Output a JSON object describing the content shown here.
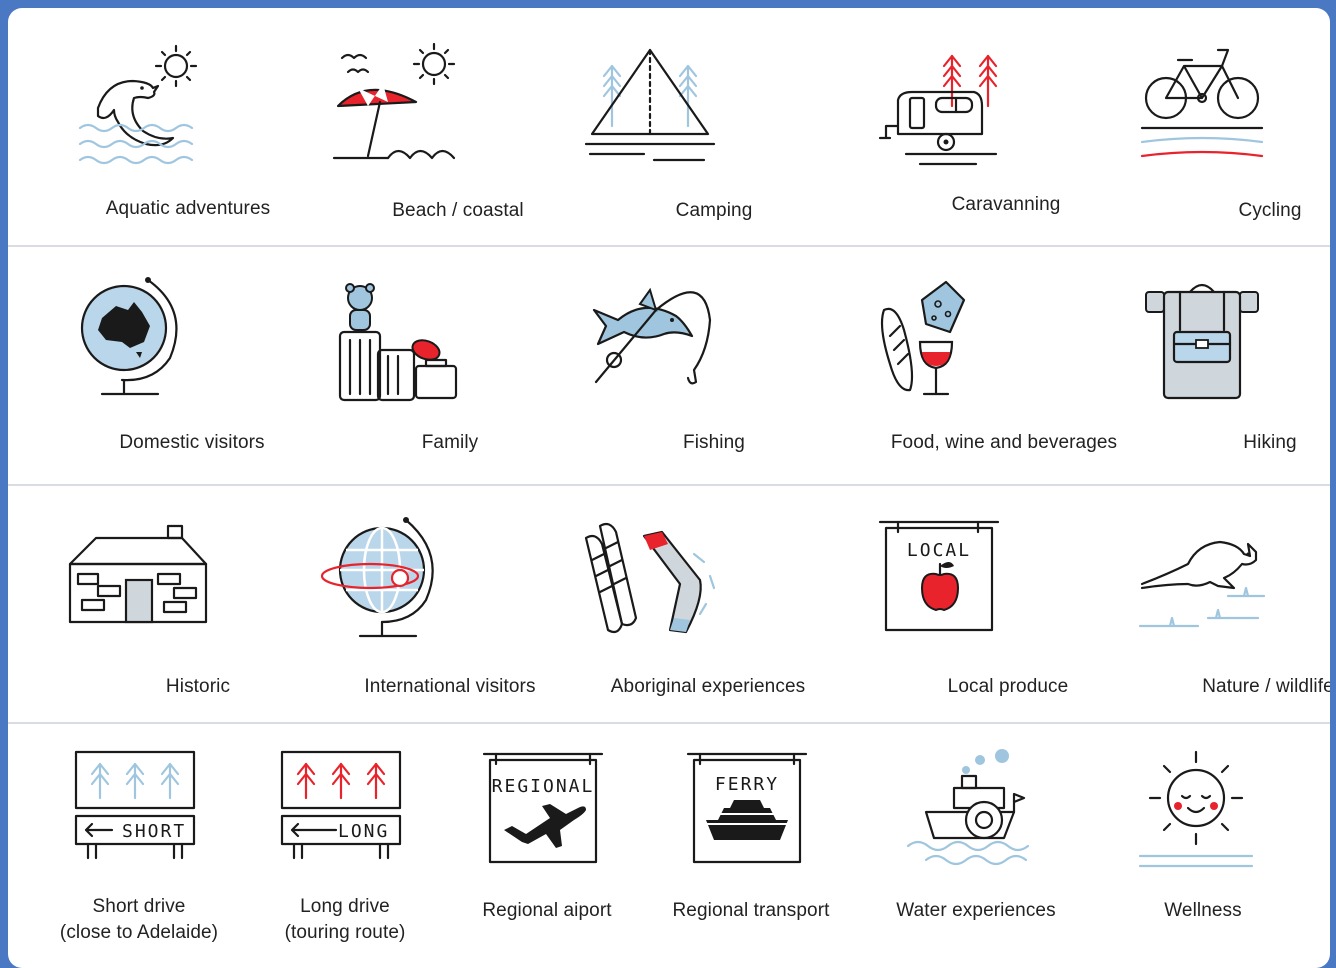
{
  "rows": [
    [
      {
        "key": "aquatic",
        "label": "Aquatic adventures",
        "icon": "dolphin-icon"
      },
      {
        "key": "beach",
        "label": "Beach / coastal",
        "icon": "beach-umbrella-icon"
      },
      {
        "key": "camping",
        "label": "Camping",
        "icon": "tent-icon"
      },
      {
        "key": "caravanning",
        "label": "Caravanning",
        "icon": "caravan-icon"
      },
      {
        "key": "cycling",
        "label": "Cycling",
        "icon": "bicycle-icon"
      }
    ],
    [
      {
        "key": "domestic",
        "label": "Domestic visitors",
        "icon": "australia-globe-icon"
      },
      {
        "key": "family",
        "label": "Family",
        "icon": "family-luggage-icon"
      },
      {
        "key": "fishing",
        "label": "Fishing",
        "icon": "fish-rod-icon"
      },
      {
        "key": "food",
        "label": "Food, wine and beverages",
        "icon": "bread-cheese-wine-icon"
      },
      {
        "key": "hiking",
        "label": "Hiking",
        "icon": "backpack-icon"
      }
    ],
    [
      {
        "key": "historic",
        "label": "Historic",
        "icon": "stone-cottage-icon"
      },
      {
        "key": "international",
        "label": "International visitors",
        "icon": "world-globe-icon"
      },
      {
        "key": "aboriginal",
        "label": "Aboriginal experiences",
        "icon": "boomerang-icon"
      },
      {
        "key": "local",
        "label": "Local produce",
        "icon": "apple-sign-icon"
      },
      {
        "key": "nature",
        "label": "Nature / wildlife",
        "icon": "kangaroo-icon"
      }
    ],
    [
      {
        "key": "short",
        "label": "Short drive",
        "label2": "(close to Adelaide)",
        "icon": "short-drive-sign-icon"
      },
      {
        "key": "long",
        "label": "Long drive",
        "label2": "(touring route)",
        "icon": "long-drive-sign-icon"
      },
      {
        "key": "airport",
        "label": "Regional aiport",
        "icon": "plane-sign-icon"
      },
      {
        "key": "transport",
        "label": "Regional transport",
        "icon": "ferry-sign-icon"
      },
      {
        "key": "water",
        "label": "Water experiences",
        "icon": "paddle-steamer-icon"
      },
      {
        "key": "wellness",
        "label": "Wellness",
        "icon": "smiling-sun-icon"
      }
    ]
  ],
  "signs": {
    "short": "SHORT",
    "long": "LONG",
    "regional": "REGIONAL",
    "ferry": "FERRY",
    "local": "LOCAL"
  },
  "colors": {
    "background": "#4a78c2",
    "card": "#ffffff",
    "accent_red": "#e8232b",
    "accent_blue": "#9fc6de",
    "ink": "#1a1a1a"
  }
}
